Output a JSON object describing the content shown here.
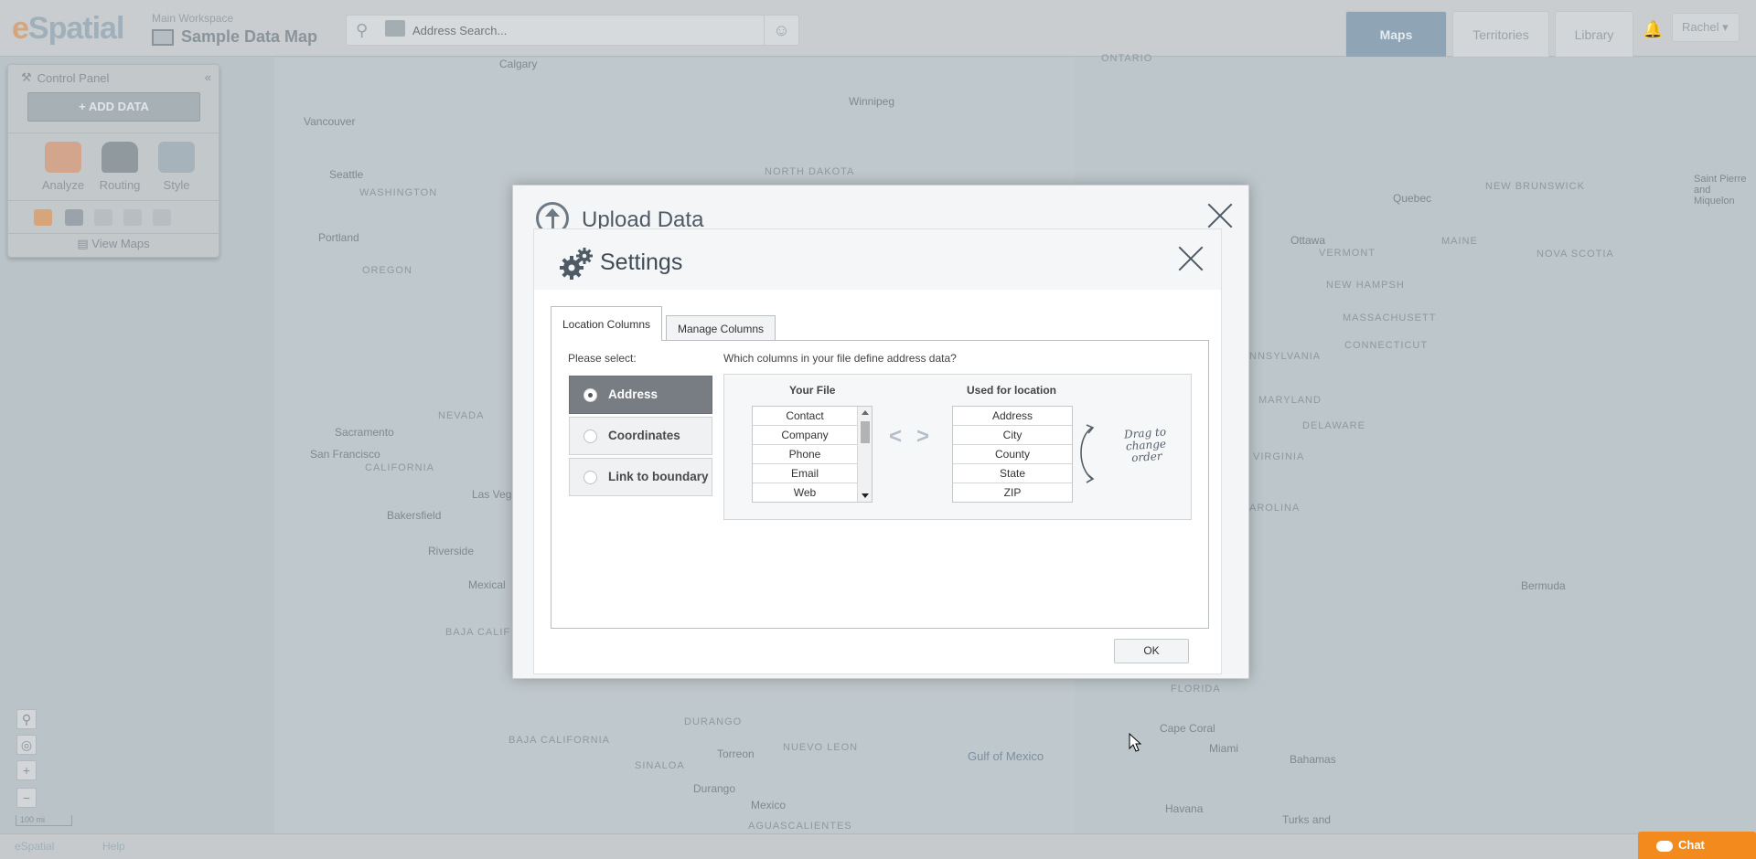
{
  "app": {
    "logo_prefix": "e",
    "logo_rest": "Spatial",
    "workspace_label": "Main Workspace",
    "map_title": "Sample Data Map"
  },
  "search": {
    "placeholder": "Address Search..."
  },
  "nav": {
    "tabs": [
      {
        "label": "Maps",
        "active": true
      },
      {
        "label": "Territories",
        "active": false
      },
      {
        "label": "Library",
        "active": false
      }
    ],
    "user": "Rachel"
  },
  "control_panel": {
    "title": "Control Panel",
    "add_data": "ADD DATA",
    "tools": [
      "Analyze",
      "Routing",
      "Style"
    ],
    "view_maps": "View Maps"
  },
  "map": {
    "labels": [
      "Calgary",
      "Winnipeg",
      "Vancouver",
      "Seattle",
      "Portland",
      "WASHINGTON",
      "OREGON",
      "NORTH DAKOTA",
      "NEVADA",
      "Sacramento",
      "San Francisco",
      "CALIFORNIA",
      "Las Veg",
      "Bakersfield",
      "Riverside",
      "Mexical",
      "BAJA CALIF",
      "Ottawa",
      "Quebec",
      "VERMONT",
      "MAINE",
      "NEW HAMPSH",
      "MASSACHUSETT",
      "CONNECTICUT",
      "NEW BRUNSWICK",
      "NOVA SCOTIA",
      "Saint Pierre and Miquelon",
      "NNSYLVANIA",
      "MARYLAND",
      "DELAWARE",
      "VIRGINIA",
      "AROLINA",
      "Bermuda",
      "Gulf of Mexico",
      "FLORIDA",
      "Cape Coral",
      "Miami",
      "Bahamas",
      "DURANGO",
      "Torreon",
      "NUEVO LEON",
      "Durango",
      "Mexico",
      "AGUASCALIENTES",
      "BAJA CALIFORNIA",
      "SINALOA",
      "Havana",
      "Turks and",
      "ONTARIO"
    ],
    "scale": "100 mi"
  },
  "footer": {
    "logo": "eSpatial",
    "help": "Help",
    "chat": "Chat"
  },
  "upload_dialog": {
    "title": "Upload Data"
  },
  "settings_dialog": {
    "title": "Settings",
    "tabs": [
      {
        "label": "Location Columns",
        "active": true
      },
      {
        "label": "Manage Columns",
        "active": false
      }
    ],
    "please_select": "Please select:",
    "options": [
      {
        "label": "Address",
        "selected": true
      },
      {
        "label": "Coordinates",
        "selected": false
      },
      {
        "label": "Link to boundary",
        "selected": false
      }
    ],
    "question": "Which columns in your file define address data?",
    "your_file_header": "Your File",
    "your_file_items": [
      "Contact",
      "Company",
      "Phone",
      "Email",
      "Web"
    ],
    "used_header": "Used for location",
    "used_items": [
      "Address",
      "City",
      "County",
      "State",
      "ZIP"
    ],
    "drag_hint": "Drag to change order",
    "move_left": "<",
    "move_right": ">",
    "ok": "OK"
  }
}
